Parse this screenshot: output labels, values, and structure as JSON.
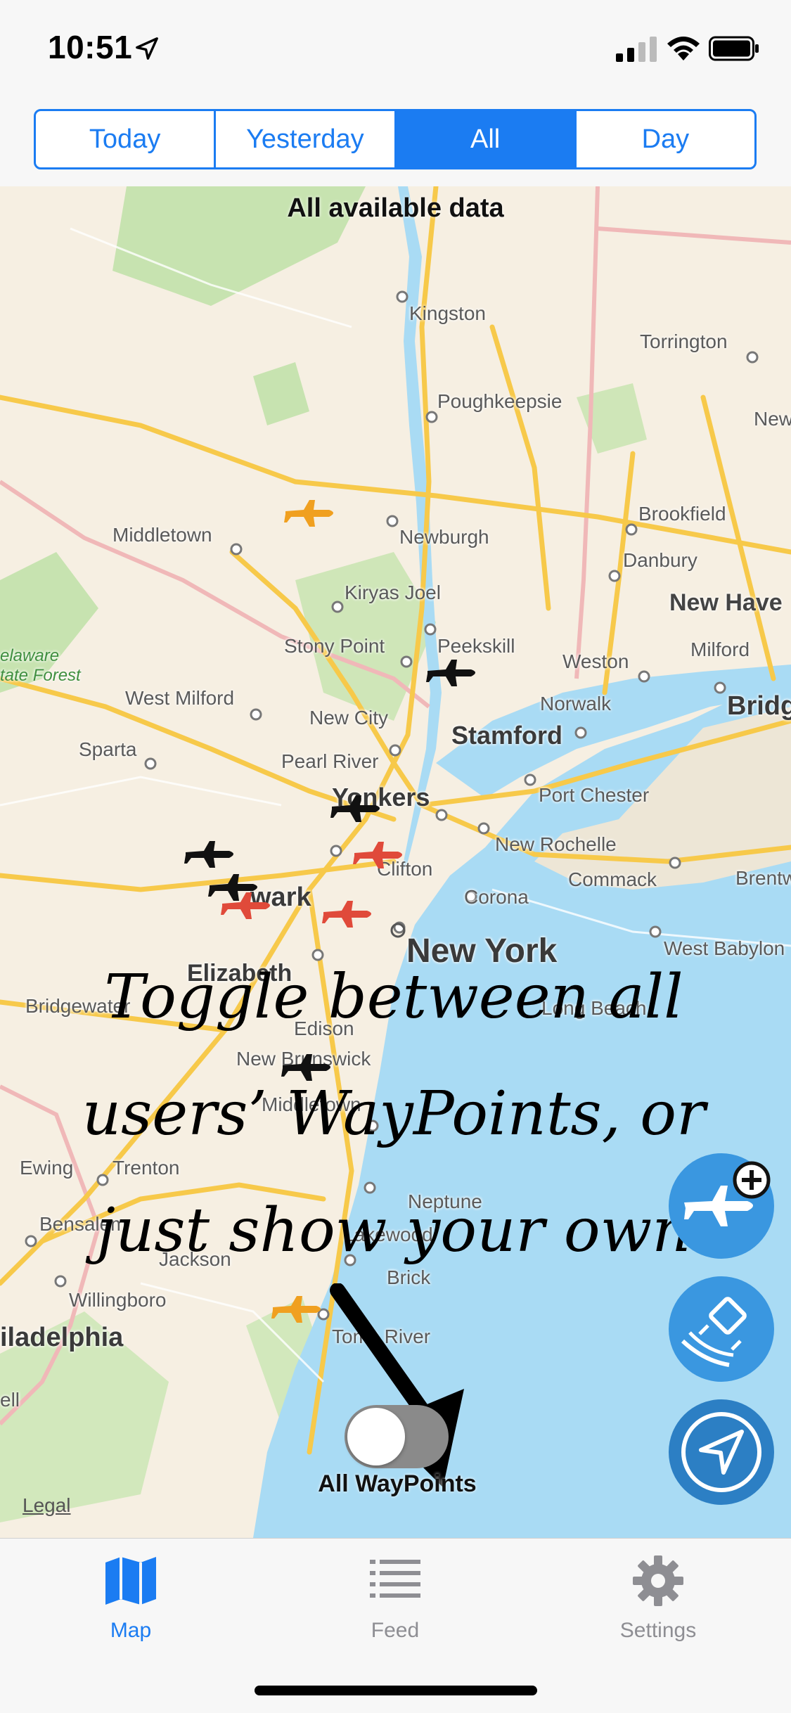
{
  "status_bar": {
    "time": "10:51"
  },
  "segmented": {
    "items": [
      "Today",
      "Yesterday",
      "All",
      "Day"
    ],
    "selected": "All"
  },
  "map": {
    "title": "All available data",
    "legal": "Legal",
    "places": {
      "kingston": "Kingston",
      "torrington": "Torrington",
      "poughkeepsie": "Poughkeepsie",
      "new_c": "New",
      "brookfield": "Brookfield",
      "middletown": "Middletown",
      "newburgh": "Newburgh",
      "danbury": "Danbury",
      "kiryas_joel": "Kiryas Joel",
      "new_haven": "New Have",
      "stony_point": "Stony Point",
      "peekskill": "Peekskill",
      "weston": "Weston",
      "milford": "Milford",
      "delaware": "elaware",
      "state_forest": "tate Forest",
      "west_milford": "West Milford",
      "new_city": "New City",
      "norwalk": "Norwalk",
      "bridgeport": "Bridg",
      "sparta": "Sparta",
      "stamford": "Stamford",
      "pearl_river": "Pearl River",
      "port_chester": "Port Chester",
      "yonkers": "Yonkers",
      "new_rochelle": "New Rochelle",
      "clifton": "Clifton",
      "commack": "Commack",
      "brentwood": "Brentwo",
      "newark": "wark",
      "corona": "Corona",
      "new_york": "New York",
      "west_babylon": "West Babylon",
      "elizabeth": "Elizabeth",
      "bridgewater": "Bridgewater",
      "edison": "Edison",
      "long_beach": "Long Beach",
      "new_brunswick": "New Brunswick",
      "middletown_nj": "Middletown",
      "ewing": "Ewing",
      "trenton": "Trenton",
      "neptune": "Neptune",
      "bensalem": "Bensalem",
      "lakewood": "Lakewood",
      "jackson": "Jackson",
      "brick": "Brick",
      "willingboro": "Willingboro",
      "philadelphia": "iladelphia",
      "toms_river": "Toms River",
      "cell": "ell"
    }
  },
  "annotation": {
    "line1": "Toggle between all",
    "line2": "users’ WayPoints, or",
    "line3": "just show your own"
  },
  "toggle": {
    "label": "All WayPoints",
    "on": false
  },
  "fab_buttons": {
    "add_waypoint": "plane-add-icon",
    "map_type": "satellite-icon",
    "locate": "location-arrow-icon"
  },
  "tabbar": {
    "items": [
      {
        "label": "Map",
        "icon": "map-icon",
        "active": true
      },
      {
        "label": "Feed",
        "icon": "list-icon",
        "active": false
      },
      {
        "label": "Settings",
        "icon": "gear-icon",
        "active": false
      }
    ]
  },
  "colors": {
    "accent": "#1b7cf2",
    "water": "#a9dbf4",
    "land": "#f6efe2",
    "park": "#c7e3b0",
    "road": "#f7c94a",
    "fab": "#3a97e0",
    "plane_orange": "#f0a020",
    "plane_red": "#e04a3a",
    "plane_black": "#111111"
  }
}
